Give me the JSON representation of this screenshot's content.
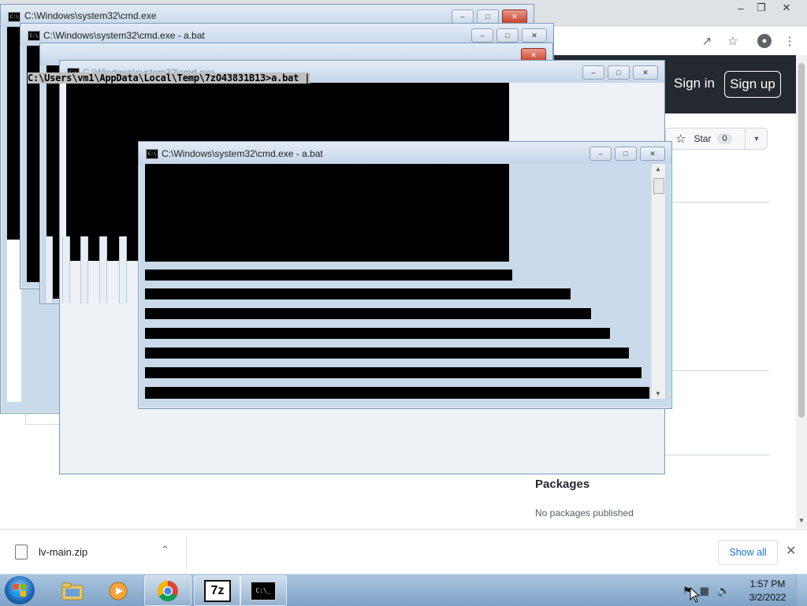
{
  "browser": {
    "signin": "Sign in",
    "signup": "Sign up",
    "star_label": "Star",
    "star_count": "0",
    "packages_title": "Packages",
    "packages_text": "No packages published"
  },
  "downloads": {
    "file_name": "lv-main.zip",
    "show_all": "Show all"
  },
  "cmd_windows": {
    "back_title": "C:\\Windows\\system32\\cmd.exe",
    "second_title": "C:\\Windows\\system32\\cmd.exe - a.bat",
    "mid_title": "C:\\Windows\\system32\\cmd.exe",
    "front_title": "C:\\Windows\\system32\\cmd.exe - a.bat",
    "prompt_line": "C:\\Users\\vm1\\AppData\\Local\\Temp\\7zO43831B13>a.bat |"
  },
  "taskbar": {
    "time": "1:57 PM",
    "date": "3/2/2022",
    "apps": [
      "explorer-icon",
      "media-player-icon",
      "chrome-icon",
      "7zip-icon",
      "cmd-icon"
    ],
    "sevenzip_label": "7z",
    "cmd_label": "C:\\_"
  },
  "colors": {
    "github_header": "#24292f",
    "console_bg": "#000000",
    "taskbar": "#8fb0d2"
  }
}
